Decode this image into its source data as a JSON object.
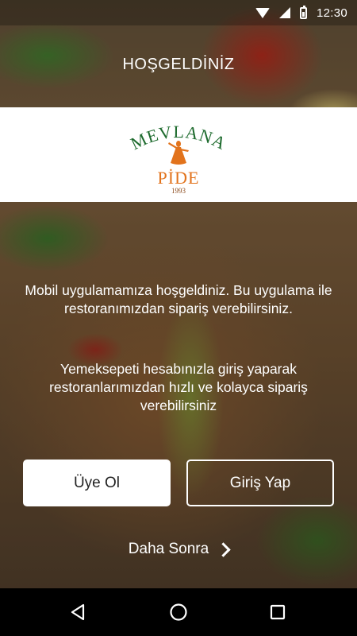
{
  "status_bar": {
    "time": "12:30"
  },
  "header": {
    "title": "HOŞGELDİNİZ"
  },
  "logo": {
    "name": "MEVLANA",
    "sub": "PİDE",
    "year": "1993",
    "colors": {
      "name": "#1e6b2e",
      "sub": "#e2731c",
      "year": "#8a4a1c"
    }
  },
  "body": {
    "welcome": "Mobil uygulamamıza hoşgeldiniz. Bu uygulama ile restoranımızdan sipariş verebilirsiniz.",
    "info": "Yemeksepeti hesabınızla giriş yaparak restoranlarımızdan hızlı ve kolayca sipariş verebilirsiniz"
  },
  "buttons": {
    "register": "Üye Ol",
    "login": "Giriş Yap",
    "later": "Daha Sonra"
  },
  "icons": {
    "wifi": "wifi-icon",
    "signal": "signal-icon",
    "battery": "battery-icon",
    "chevron": "chevron-right-icon",
    "back": "back-triangle-icon",
    "home": "home-circle-icon",
    "recent": "recent-square-icon"
  }
}
